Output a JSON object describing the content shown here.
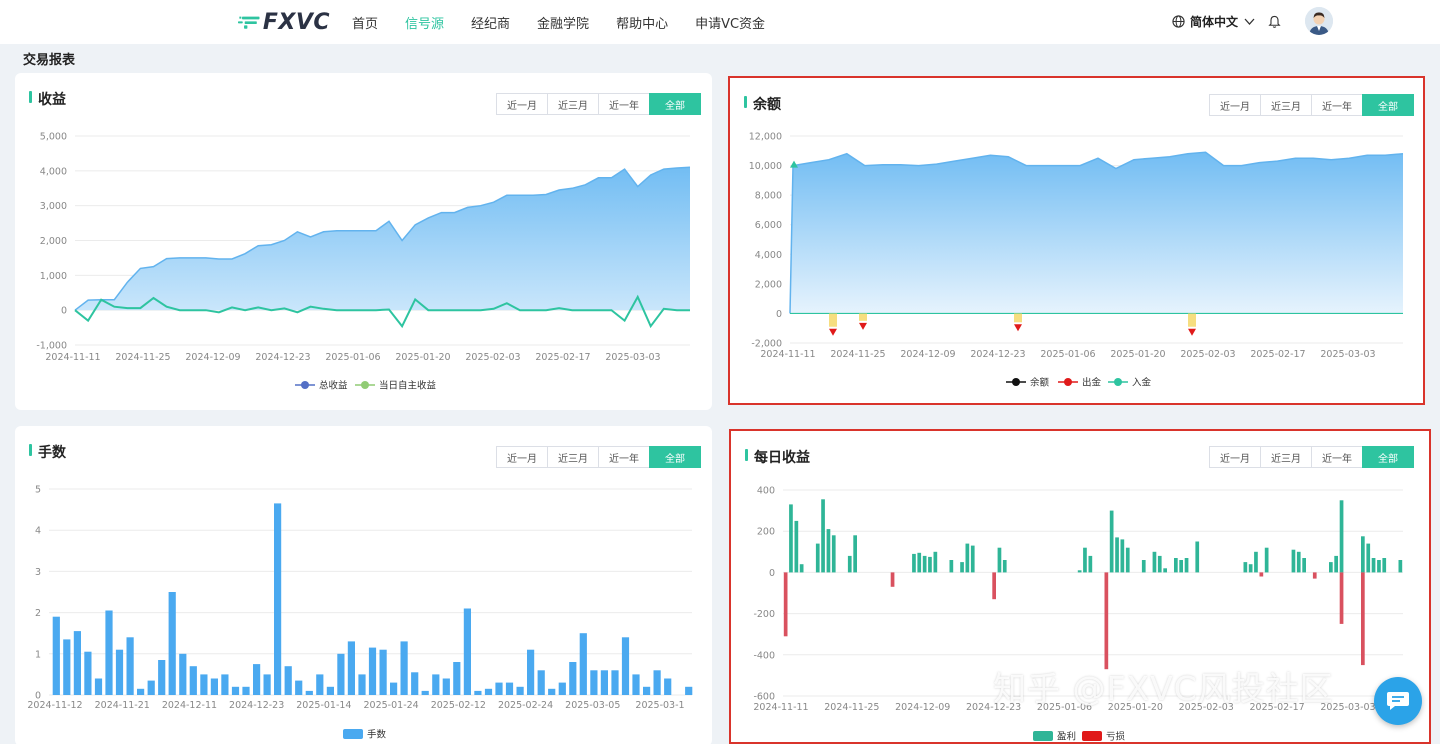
{
  "header": {
    "logo_text": "FXVC",
    "nav": [
      {
        "label": "首页",
        "active": false
      },
      {
        "label": "信号源",
        "active": true
      },
      {
        "label": "经纪商",
        "active": false
      },
      {
        "label": "金融学院",
        "active": false
      },
      {
        "label": "帮助中心",
        "active": false
      },
      {
        "label": "申请VC资金",
        "active": false
      }
    ],
    "language": "简体中文"
  },
  "page_title": "交易报表",
  "tabs": [
    "近一月",
    "近三月",
    "近一年",
    "全部"
  ],
  "active_tab": "全部",
  "colors": {
    "accent": "#2ec4a0",
    "area_fill": "#7cc3f5",
    "area_line": "#6fb8ef",
    "bar_blue": "#4aa9f0",
    "profit_green": "#2fb597",
    "loss_red": "#d9515f",
    "highlight_border": "#d9342b"
  },
  "watermark": "知乎 @FXVC风投社区",
  "chart_data": [
    {
      "id": "income",
      "title": "收益",
      "type": "area",
      "x_labels": [
        "2024-11-11",
        "2024-11-25",
        "2024-12-09",
        "2024-12-23",
        "2025-01-06",
        "2025-01-20",
        "2025-02-03",
        "2025-02-17",
        "2025-03-03"
      ],
      "ylim": [
        -1000,
        5000
      ],
      "yticks": [
        "5,000",
        "4,000",
        "3,000",
        "2,000",
        "1,000",
        "0",
        "-1,000"
      ],
      "series": [
        {
          "name": "总收益",
          "values": [
            0,
            290,
            300,
            300,
            800,
            1200,
            1250,
            1480,
            1500,
            1500,
            1500,
            1470,
            1470,
            1620,
            1850,
            1880,
            2000,
            2250,
            2100,
            2250,
            2280,
            2280,
            2280,
            2280,
            2550,
            2000,
            2450,
            2650,
            2800,
            2800,
            2950,
            3000,
            3100,
            3300,
            3300,
            3300,
            3320,
            3450,
            3500,
            3600,
            3800,
            3800,
            4050,
            3550,
            3880,
            4050,
            4080,
            4100
          ]
        },
        {
          "name": "当日自主收益",
          "values": [
            0,
            -300,
            300,
            100,
            60,
            60,
            350,
            100,
            0,
            0,
            0,
            -60,
            80,
            0,
            80,
            0,
            50,
            -60,
            100,
            40,
            0,
            0,
            0,
            0,
            20,
            -460,
            310,
            0,
            0,
            0,
            0,
            0,
            40,
            200,
            0,
            0,
            0,
            60,
            0,
            0,
            0,
            0,
            -300,
            380,
            -460,
            40,
            0,
            0
          ]
        }
      ]
    },
    {
      "id": "balance",
      "title": "余额",
      "type": "area",
      "x_labels": [
        "2024-11-11",
        "2024-11-25",
        "2024-12-09",
        "2024-12-23",
        "2025-01-06",
        "2025-01-20",
        "2025-02-03",
        "2025-02-17",
        "2025-03-03"
      ],
      "ylim": [
        -2000,
        12000
      ],
      "yticks": [
        "12,000",
        "10,000",
        "8,000",
        "6,000",
        "4,000",
        "2,000",
        "0",
        "-2,000"
      ],
      "series": [
        {
          "name": "余额",
          "values": [
            0,
            10000,
            10200,
            10400,
            10800,
            10000,
            10050,
            10050,
            10000,
            10100,
            10300,
            10500,
            10700,
            10600,
            10000,
            10000,
            10000,
            10000,
            10500,
            9800,
            10400,
            10500,
            10600,
            10800,
            10900,
            10000,
            10000,
            10200,
            10300,
            10500,
            10500,
            10400,
            10500,
            10700,
            10700,
            10800
          ]
        },
        {
          "name": "出金",
          "points": [
            {
              "x": "2024-11-19",
              "y": -900
            },
            {
              "x": "2024-11-26",
              "y": -500
            },
            {
              "x": "2024-12-26",
              "y": -600
            },
            {
              "x": "2025-02-02",
              "y": -900
            }
          ]
        },
        {
          "name": "入金",
          "points": [
            {
              "x": "2024-11-12",
              "y": 10000
            }
          ]
        }
      ],
      "legend": [
        "余额",
        "出金",
        "入金"
      ]
    },
    {
      "id": "lots",
      "title": "手数",
      "type": "bar",
      "x_labels": [
        "2024-11-12",
        "2024-11-21",
        "2024-12-11",
        "2024-12-23",
        "2025-01-14",
        "2025-01-24",
        "2025-02-12",
        "2025-02-24",
        "2025-03-05",
        "2025-03-1"
      ],
      "ylim": [
        0,
        5
      ],
      "yticks": [
        "5",
        "4",
        "3",
        "2",
        "1",
        "0"
      ],
      "series": [
        {
          "name": "手数",
          "values": [
            1.9,
            1.35,
            1.55,
            1.05,
            0.4,
            2.05,
            1.1,
            1.4,
            0.15,
            0.35,
            0.85,
            2.5,
            1.0,
            0.7,
            0.5,
            0.4,
            0.5,
            0.2,
            0.2,
            0.75,
            0.5,
            4.65,
            0.7,
            0.35,
            0.1,
            0.5,
            0.2,
            1.0,
            1.3,
            0.5,
            1.15,
            1.1,
            0.3,
            1.3,
            0.55,
            0.1,
            0.5,
            0.4,
            0.8,
            2.1,
            0.1,
            0.15,
            0.3,
            0.3,
            0.2,
            1.1,
            0.6,
            0.15,
            0.3,
            0.8,
            1.5,
            0.6,
            0.6,
            0.6,
            1.4,
            0.5,
            0.2,
            0.6,
            0.4,
            0.0,
            0.2
          ]
        }
      ]
    },
    {
      "id": "daily",
      "title": "每日收益",
      "type": "bar",
      "x_labels": [
        "2024-11-11",
        "2024-11-25",
        "2024-12-09",
        "2024-12-23",
        "2025-01-06",
        "2025-01-20",
        "2025-02-03",
        "2025-02-17",
        "2025-03-03"
      ],
      "ylim": [
        -600,
        400
      ],
      "yticks": [
        "400",
        "200",
        "0",
        "-200",
        "-400",
        "-600"
      ],
      "series": [
        {
          "name": "盈利",
          "values": [
            0,
            330,
            250,
            40,
            0,
            0,
            140,
            355,
            210,
            180,
            0,
            0,
            80,
            180,
            0,
            0,
            0,
            0,
            0,
            0,
            0,
            0,
            0,
            0,
            90,
            95,
            80,
            75,
            100,
            0,
            0,
            60,
            0,
            50,
            140,
            130,
            0,
            0,
            0,
            0,
            120,
            60,
            0,
            0,
            0,
            0,
            0,
            0,
            0,
            0,
            0,
            0,
            0,
            0,
            0,
            10,
            120,
            80,
            0,
            0,
            0,
            300,
            170,
            160,
            120,
            0,
            0,
            60,
            0,
            100,
            80,
            20,
            0,
            70,
            60,
            70,
            0,
            150,
            0,
            0,
            0,
            0,
            0,
            0,
            0,
            0,
            50,
            40,
            100,
            0,
            120,
            0,
            0,
            0,
            0,
            110,
            100,
            70,
            0,
            0,
            0,
            0,
            50,
            80,
            350,
            0,
            0,
            0,
            175,
            140,
            70,
            60,
            70,
            0,
            0,
            60
          ]
        },
        {
          "name": "亏损",
          "values": [
            -310,
            0,
            0,
            0,
            0,
            0,
            0,
            0,
            0,
            0,
            0,
            0,
            0,
            0,
            0,
            0,
            0,
            0,
            0,
            0,
            -70,
            0,
            0,
            0,
            0,
            0,
            0,
            0,
            0,
            0,
            0,
            0,
            0,
            0,
            0,
            0,
            0,
            0,
            0,
            -130,
            0,
            0,
            0,
            0,
            0,
            0,
            0,
            0,
            0,
            0,
            0,
            0,
            0,
            0,
            0,
            0,
            0,
            0,
            0,
            0,
            -470,
            0,
            0,
            0,
            0,
            0,
            0,
            0,
            0,
            0,
            0,
            0,
            0,
            0,
            0,
            0,
            0,
            0,
            0,
            0,
            0,
            0,
            0,
            0,
            0,
            0,
            0,
            0,
            0,
            -20,
            0,
            0,
            0,
            0,
            0,
            0,
            0,
            0,
            0,
            -30,
            0,
            0,
            0,
            0,
            -250,
            0,
            0,
            0,
            -450,
            0,
            0,
            0,
            0,
            0,
            0,
            0,
            0
          ]
        }
      ]
    }
  ]
}
